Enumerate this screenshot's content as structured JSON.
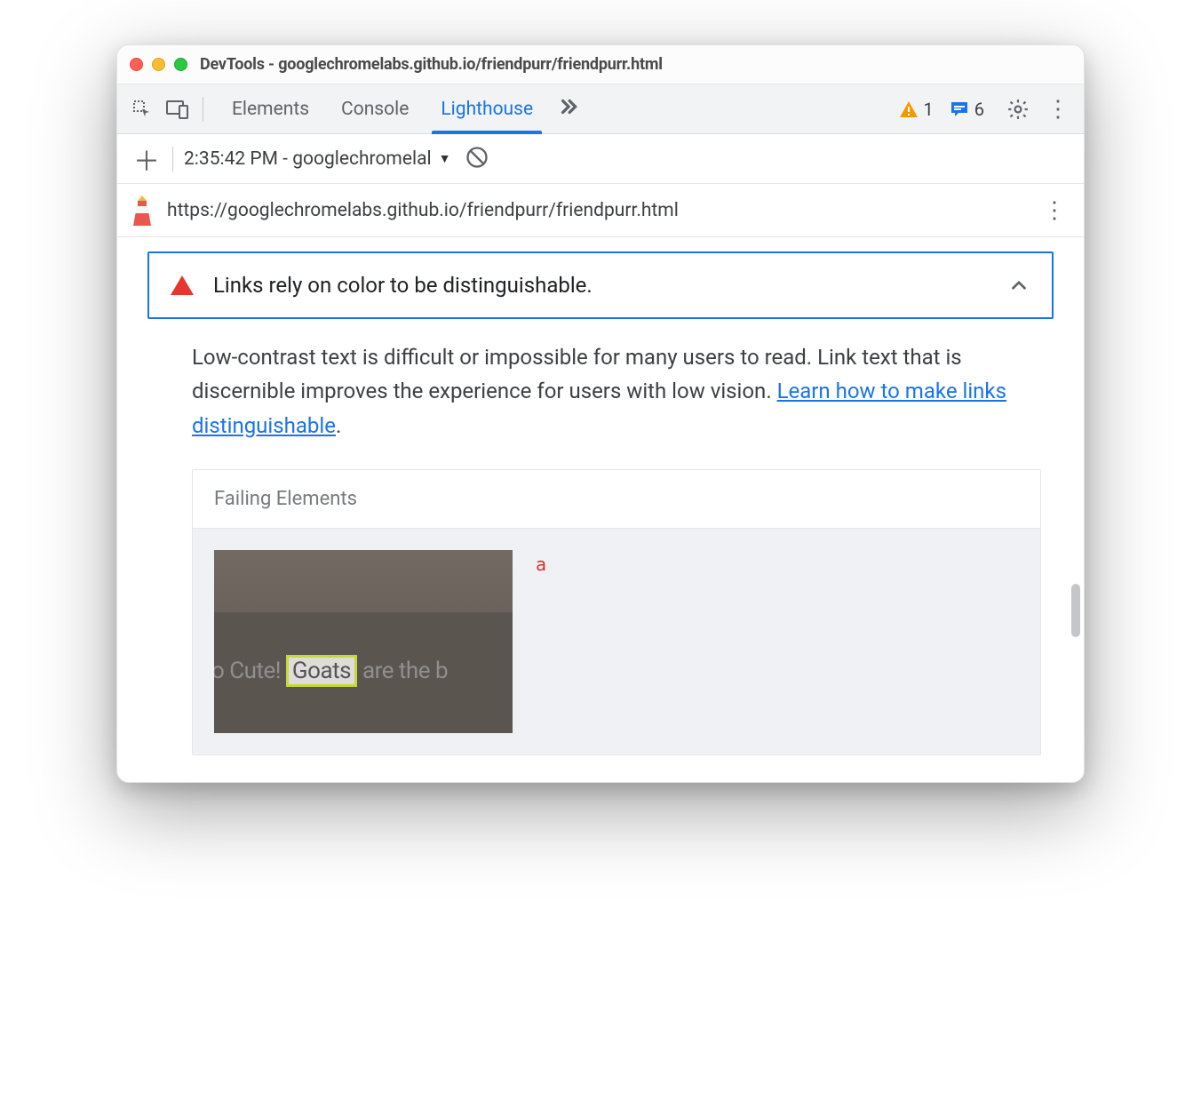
{
  "window_title": "DevTools - googlechromelabs.github.io/friendpurr/friendpurr.html",
  "tabs": {
    "elements": "Elements",
    "console": "Console",
    "lighthouse": "Lighthouse"
  },
  "counts": {
    "warnings": "1",
    "messages": "6"
  },
  "lh_run_label": "2:35:42 PM - googlechromelal",
  "url": "https://googlechromelabs.github.io/friendpurr/friendpurr.html",
  "audit": {
    "title": "Links rely on color to be distinguishable.",
    "desc_pre": "Low-contrast text is difficult or impossible for many users to read. Link text that is discernible improves the experience for users with low vision. ",
    "desc_link": "Learn how to make links distinguishable",
    "desc_post": "."
  },
  "failing": {
    "heading": "Failing Elements",
    "tag": "a",
    "thumb_text_pre": "So Cute! ",
    "thumb_text_hl": "Goats",
    "thumb_text_post": " are the b"
  }
}
